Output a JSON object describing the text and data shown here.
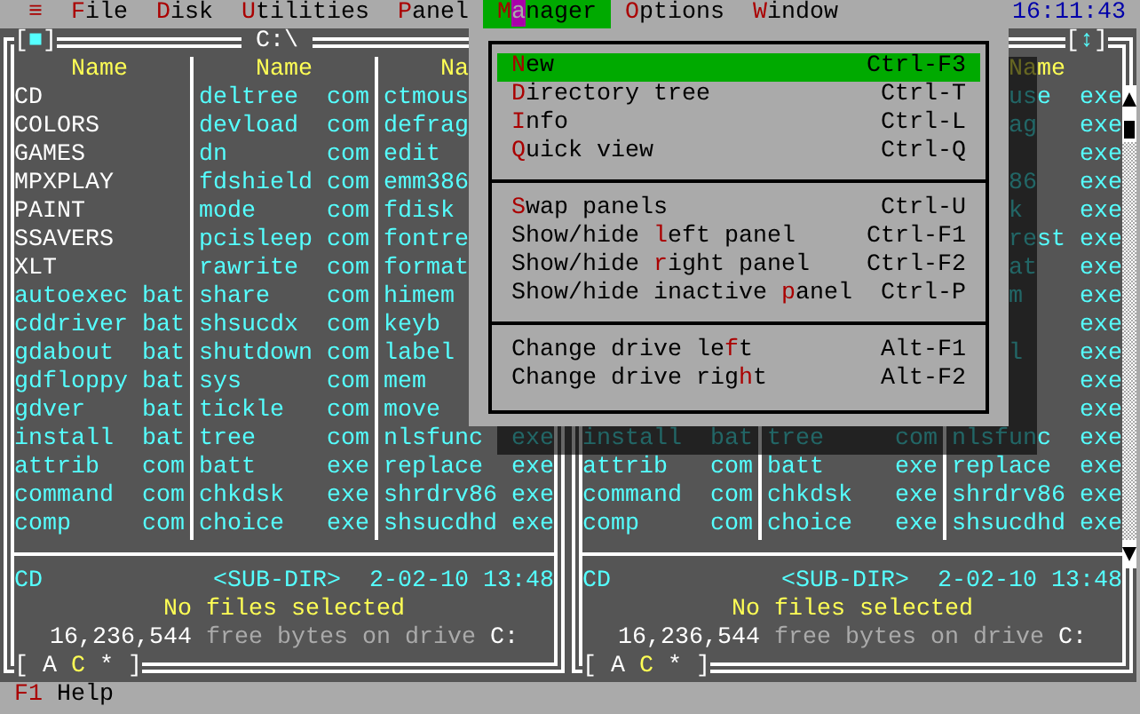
{
  "menu_bar": {
    "items": [
      {
        "hotkey": "≡",
        "selected": false
      },
      {
        "hotkey": "F",
        "after": "ile",
        "selected": false
      },
      {
        "hotkey": "D",
        "after": "isk",
        "selected": false
      },
      {
        "hotkey": "U",
        "after": "tilities",
        "selected": false
      },
      {
        "hotkey": "P",
        "after": "anel",
        "selected": false
      },
      {
        "hotkey": "M",
        "cursor": "a",
        "after": "nager",
        "selected": true
      },
      {
        "hotkey": "O",
        "after": "ptions",
        "selected": false
      },
      {
        "hotkey": "W",
        "after": "indow",
        "selected": false
      }
    ],
    "clock": "16:11:43"
  },
  "left_panel": {
    "close_box": {
      "open": "[",
      "mark": "■",
      "close": "]"
    },
    "title": "C:\\",
    "headers": {
      "column_1": "Name",
      "column_2": "Name",
      "column_3": "Na"
    },
    "rows": [
      {
        "column_1": {
          "name": "CD",
          "kind": "dir"
        },
        "column_2": {
          "name": "deltree",
          "ext": "com",
          "kind": "file"
        },
        "column_3": {
          "name": "ctmous",
          "kind": "file"
        }
      },
      {
        "column_1": {
          "name": "COLORS",
          "kind": "dir"
        },
        "column_2": {
          "name": "devload",
          "ext": "com",
          "kind": "file"
        },
        "column_3": {
          "name": "defrag",
          "kind": "file"
        }
      },
      {
        "column_1": {
          "name": "GAMES",
          "kind": "dir"
        },
        "column_2": {
          "name": "dn",
          "ext": "com",
          "kind": "file"
        },
        "column_3": {
          "name": "edit",
          "kind": "file"
        }
      },
      {
        "column_1": {
          "name": "MPXPLAY",
          "kind": "dir"
        },
        "column_2": {
          "name": "fdshield",
          "ext": "com",
          "kind": "file"
        },
        "column_3": {
          "name": "emm386",
          "kind": "file"
        }
      },
      {
        "column_1": {
          "name": "PAINT",
          "kind": "dir"
        },
        "column_2": {
          "name": "mode",
          "ext": "com",
          "kind": "file"
        },
        "column_3": {
          "name": "fdisk",
          "kind": "file"
        }
      },
      {
        "column_1": {
          "name": "SSAVERS",
          "kind": "dir"
        },
        "column_2": {
          "name": "pcisleep",
          "ext": "com",
          "kind": "file"
        },
        "column_3": {
          "name": "fontre",
          "kind": "file"
        }
      },
      {
        "column_1": {
          "name": "XLT",
          "kind": "dir"
        },
        "column_2": {
          "name": "rawrite",
          "ext": "com",
          "kind": "file"
        },
        "column_3": {
          "name": "format",
          "kind": "file"
        }
      },
      {
        "column_1": {
          "name": "autoexec",
          "ext": "bat",
          "kind": "file"
        },
        "column_2": {
          "name": "share",
          "ext": "com",
          "kind": "file"
        },
        "column_3": {
          "name": "himem",
          "kind": "file"
        }
      },
      {
        "column_1": {
          "name": "cddriver",
          "ext": "bat",
          "kind": "file"
        },
        "column_2": {
          "name": "shsucdx",
          "ext": "com",
          "kind": "file"
        },
        "column_3": {
          "name": "keyb",
          "kind": "file"
        }
      },
      {
        "column_1": {
          "name": "gdabout",
          "ext": "bat",
          "kind": "file"
        },
        "column_2": {
          "name": "shutdown",
          "ext": "com",
          "kind": "file"
        },
        "column_3": {
          "name": "label",
          "kind": "file"
        }
      },
      {
        "column_1": {
          "name": "gdfloppy",
          "ext": "bat",
          "kind": "file"
        },
        "column_2": {
          "name": "sys",
          "ext": "com",
          "kind": "file"
        },
        "column_3": {
          "name": "mem",
          "kind": "file"
        }
      },
      {
        "column_1": {
          "name": "gdver",
          "ext": "bat",
          "kind": "file"
        },
        "column_2": {
          "name": "tickle",
          "ext": "com",
          "kind": "file"
        },
        "column_3": {
          "name": "move",
          "kind": "file"
        }
      },
      {
        "column_1": {
          "name": "install",
          "ext": "bat",
          "kind": "file"
        },
        "column_2": {
          "name": "tree",
          "ext": "com",
          "kind": "file"
        },
        "column_3": {
          "name": "nlsfunc",
          "ext": "exe",
          "kind": "file"
        }
      },
      {
        "column_1": {
          "name": "attrib",
          "ext": "com",
          "kind": "file"
        },
        "column_2": {
          "name": "batt",
          "ext": "exe",
          "kind": "file"
        },
        "column_3": {
          "name": "replace",
          "ext": "exe",
          "kind": "file"
        }
      },
      {
        "column_1": {
          "name": "command",
          "ext": "com",
          "kind": "file"
        },
        "column_2": {
          "name": "chkdsk",
          "ext": "exe",
          "kind": "file"
        },
        "column_3": {
          "name": "shrdrv86",
          "ext": "exe",
          "kind": "file"
        }
      },
      {
        "column_1": {
          "name": "comp",
          "ext": "com",
          "kind": "file"
        },
        "column_2": {
          "name": "choice",
          "ext": "exe",
          "kind": "file"
        },
        "column_3": {
          "name": "shsucdhd",
          "ext": "exe",
          "kind": "file"
        }
      }
    ],
    "info": {
      "name": "CD",
      "type": "<SUB-DIR>",
      "date": "2-02-10",
      "time": "13:48"
    },
    "selection": "No files selected",
    "free_bytes": "16,236,544",
    "free_text": "free bytes on drive",
    "drive": "C:",
    "drive_bar": {
      "open": "[",
      "drives": [
        {
          "label": "A",
          "selected": false
        },
        {
          "label": "C",
          "selected": true
        },
        {
          "label": "*",
          "selected": false
        }
      ],
      "close": "]"
    }
  },
  "right_panel": {
    "size_box": {
      "open": "[",
      "mark": "↕",
      "close": "]"
    },
    "headers": {
      "column_3": "Name"
    },
    "rows": [
      {
        "column_3": {
          "name": "use",
          "ext": "exe",
          "kind": "file"
        }
      },
      {
        "column_3": {
          "name": "ag",
          "ext": "exe",
          "kind": "file"
        }
      },
      {
        "column_3": {
          "ext": "exe",
          "kind": "file"
        }
      },
      {
        "column_3": {
          "name": "86",
          "ext": "exe",
          "kind": "file"
        }
      },
      {
        "column_3": {
          "name": "k",
          "ext": "exe",
          "kind": "file"
        }
      },
      {
        "column_3": {
          "name": "rest",
          "ext": "exe",
          "kind": "file"
        }
      },
      {
        "column_3": {
          "name": "at",
          "ext": "exe",
          "kind": "file"
        }
      },
      {
        "column_3": {
          "name": "m",
          "ext": "exe",
          "kind": "file"
        }
      },
      {
        "column_3": {
          "ext": "exe",
          "kind": "file"
        }
      },
      {
        "column_3": {
          "name": "l",
          "ext": "exe",
          "kind": "file"
        }
      },
      {
        "column_3": {
          "ext": "exe",
          "kind": "file"
        }
      },
      {
        "column_3": {
          "ext": "exe",
          "kind": "file"
        }
      },
      {
        "column_1": {
          "name": "install",
          "ext": "bat",
          "kind": "file"
        },
        "column_2": {
          "name": "tree",
          "ext": "com",
          "kind": "file"
        },
        "column_3": {
          "name": "nlsfunc",
          "ext": "exe",
          "kind": "file"
        }
      },
      {
        "column_1": {
          "name": "attrib",
          "ext": "com",
          "kind": "file"
        },
        "column_2": {
          "name": "batt",
          "ext": "exe",
          "kind": "file"
        },
        "column_3": {
          "name": "replace",
          "ext": "exe",
          "kind": "file"
        }
      },
      {
        "column_1": {
          "name": "command",
          "ext": "com",
          "kind": "file"
        },
        "column_2": {
          "name": "chkdsk",
          "ext": "exe",
          "kind": "file"
        },
        "column_3": {
          "name": "shrdrv86",
          "ext": "exe",
          "kind": "file"
        }
      },
      {
        "column_1": {
          "name": "comp",
          "ext": "com",
          "kind": "file"
        },
        "column_2": {
          "name": "choice",
          "ext": "exe",
          "kind": "file"
        },
        "column_3": {
          "name": "shsucdhd",
          "ext": "exe",
          "kind": "file"
        }
      }
    ],
    "info": {
      "name": "CD",
      "type": "<SUB-DIR>",
      "date": "2-02-10",
      "time": "13:48"
    },
    "selection": "No files selected",
    "free_bytes": "16,236,544",
    "free_text": "free bytes on drive",
    "drive": "C:",
    "drive_bar": {
      "open": "[",
      "drives": [
        {
          "label": "A",
          "selected": false
        },
        {
          "label": "C",
          "selected": true
        },
        {
          "label": "*",
          "selected": false
        }
      ],
      "close": "]"
    }
  },
  "manager_menu": {
    "groups": [
      [
        {
          "hotkey": "N",
          "after": "ew",
          "shortcut": "Ctrl-F3",
          "selected": true
        },
        {
          "hotkey": "D",
          "after": "irectory tree",
          "shortcut": "Ctrl-T",
          "selected": false
        },
        {
          "hotkey": "I",
          "after": "nfo",
          "shortcut": "Ctrl-L",
          "selected": false
        },
        {
          "hotkey": "Q",
          "after": "uick view",
          "shortcut": "Ctrl-Q",
          "selected": false
        }
      ],
      [
        {
          "hotkey": "S",
          "after": "wap panels",
          "shortcut": "Ctrl-U",
          "selected": false
        },
        {
          "before": "Show/hide ",
          "hotkey": "l",
          "after": "eft panel",
          "shortcut": "Ctrl-F1",
          "selected": false
        },
        {
          "before": "Show/hide ",
          "hotkey": "r",
          "after": "ight panel",
          "shortcut": "Ctrl-F2",
          "selected": false
        },
        {
          "before": "Show/hide inactive ",
          "hotkey": "p",
          "after": "anel",
          "shortcut": "Ctrl-P",
          "selected": false
        }
      ],
      [
        {
          "before": "Change drive le",
          "hotkey": "f",
          "after": "t",
          "shortcut": "Alt-F1",
          "selected": false
        },
        {
          "before": "Change drive rig",
          "hotkey": "h",
          "after": "t",
          "shortcut": "Alt-F2",
          "selected": false
        }
      ]
    ]
  },
  "function_keys": [
    {
      "key": "F1",
      "label": "Help"
    }
  ]
}
